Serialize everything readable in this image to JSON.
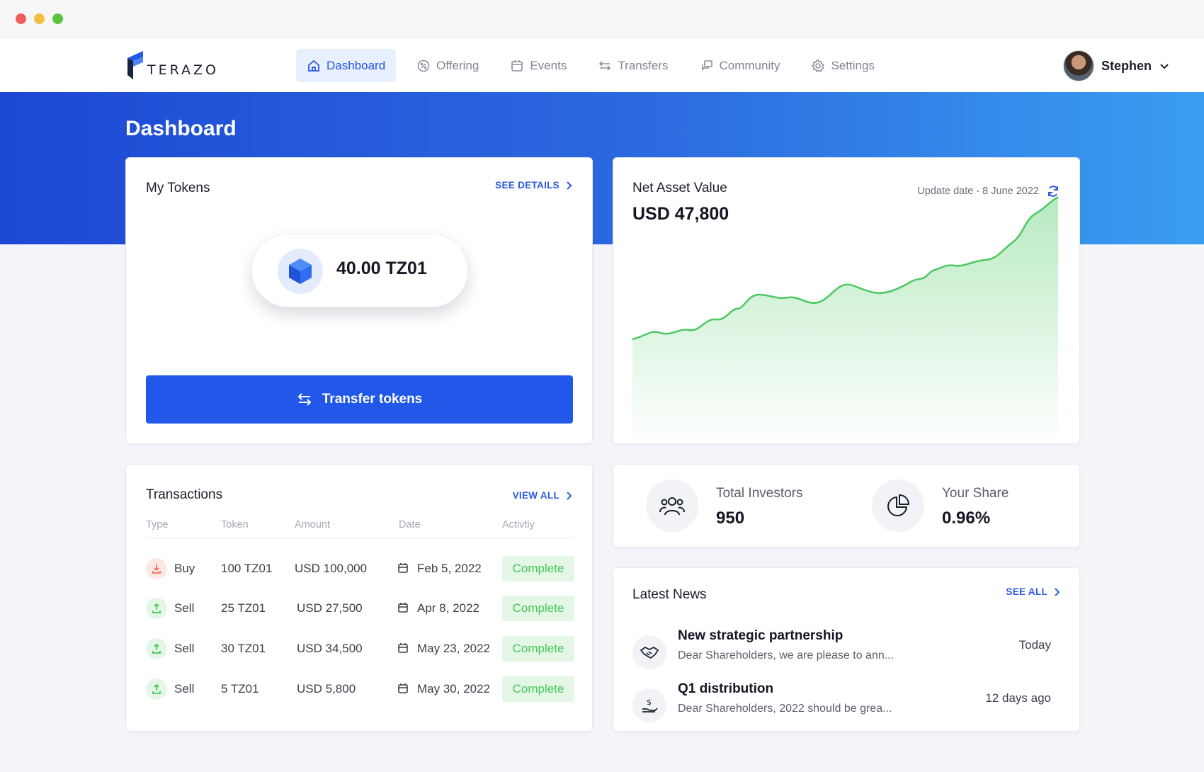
{
  "brand": {
    "name": "TERAZO",
    "primary": "#2158ea",
    "success": "#45c85a",
    "danger": "#f06a5a"
  },
  "nav": {
    "items": [
      {
        "label": "Dashboard",
        "icon": "home-icon",
        "active": true
      },
      {
        "label": "Offering",
        "icon": "badge-percent-icon",
        "active": false
      },
      {
        "label": "Events",
        "icon": "calendar-icon",
        "active": false
      },
      {
        "label": "Transfers",
        "icon": "arrows-swap-icon",
        "active": false
      },
      {
        "label": "Community",
        "icon": "chat-icon",
        "active": false
      },
      {
        "label": "Settings",
        "icon": "gear-icon",
        "active": false
      }
    ],
    "user": {
      "name": "Stephen"
    }
  },
  "page": {
    "title": "Dashboard"
  },
  "tokens": {
    "title": "My Tokens",
    "see_details": "SEE DETAILS",
    "amount": "40.00 TZ01",
    "transfer_label": "Transfer tokens"
  },
  "nav_card": {
    "title": "Net Asset Value",
    "value": "USD 47,800",
    "update": "Update date - 8 June 2022"
  },
  "transactions": {
    "title": "Transactions",
    "view_all": "VIEW ALL",
    "columns": [
      "Type",
      "Token",
      "Amount",
      "Date",
      "Activtiy"
    ],
    "rows": [
      {
        "type": "Buy",
        "token": "100 TZ01",
        "amount": "USD 100,000",
        "date": "Feb 5, 2022",
        "status": "Complete"
      },
      {
        "type": "Sell",
        "token": "25 TZ01",
        "amount": "USD 27,500",
        "date": "Apr 8, 2022",
        "status": "Complete"
      },
      {
        "type": "Sell",
        "token": "30 TZ01",
        "amount": "USD 34,500",
        "date": "May 23, 2022",
        "status": "Complete"
      },
      {
        "type": "Sell",
        "token": "5 TZ01",
        "amount": "USD 5,800",
        "date": "May 30, 2022",
        "status": "Complete"
      }
    ]
  },
  "stats": {
    "investors_label": "Total Investors",
    "investors_value": "950",
    "share_label": "Your Share",
    "share_value": "0.96%"
  },
  "news": {
    "title": "Latest News",
    "see_all": "SEE ALL",
    "items": [
      {
        "title": "New strategic partnership",
        "body": "Dear Shareholders, we are please to ann...",
        "time": "Today",
        "icon": "handshake-icon"
      },
      {
        "title": "Q1 distribution",
        "body": "Dear Shareholders, 2022 should be grea...",
        "time": "12 days ago",
        "icon": "dollar-hand-icon"
      }
    ]
  }
}
